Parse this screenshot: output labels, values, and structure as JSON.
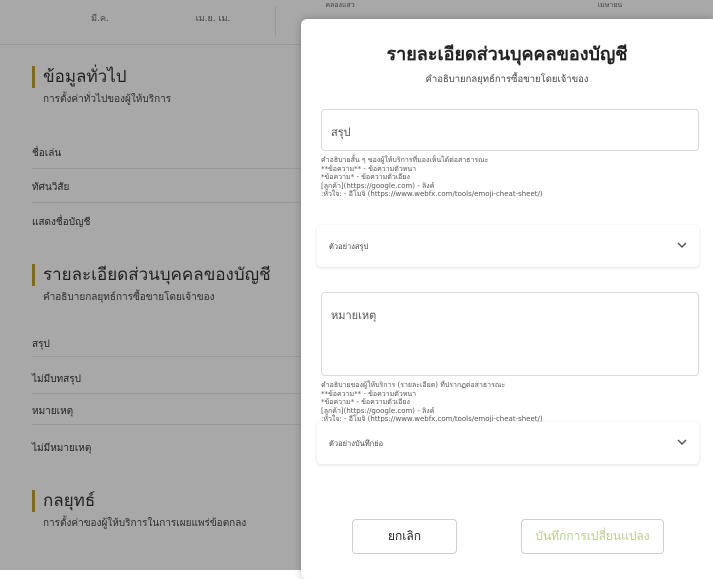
{
  "background": {
    "header": {
      "col1": "มี.ค.",
      "col2": "เม.ย. เม.",
      "col3_top": "คลองแสว",
      "col4_top": "เมษายน"
    },
    "general": {
      "title": "ข้อมูลทั่วไป",
      "desc": "การตั้งค่าทั่วไปของผู้ให้บริการ",
      "rows": [
        "ชื่อเล่น",
        "ทัศนวิสัย",
        "แสดงชื่อบัญชี"
      ]
    },
    "account": {
      "title": "รายละเอียดส่วนบุคคลของบัญชี",
      "desc": "คำอธิบายกลยุทธ์การซื้อขายโดยเจ้าของ",
      "rows": [
        "สรุป",
        "ไม่มีบทสรุป",
        "หมายเหตุ",
        "ไม่มีหมายเหตุ"
      ]
    },
    "strategy": {
      "title": "กลยุทธ์",
      "desc": "การตั้งค่าของผู้ให้บริการในการเผยแพร่ข้อตกลง"
    }
  },
  "modal": {
    "title": "รายละเอียดส่วนบุคคลของบัญชี",
    "subtitle": "คำอธิบายกลยุทธ์การซื้อขายโดยเจ้าของ",
    "summary": {
      "placeholder": "สรุป",
      "help": [
        "คำอธิบายสั้น ๆ ของผู้ให้บริการที่มองเห็นได้ต่อสาธารณะ",
        "**ข้อความ** - ข้อความตัวหนา",
        "*ข้อความ* - ข้อความตัวเอียง",
        "[ลูกค้า](https://google.com) - ลิงค์",
        ":หัวใจ: - อีโมจิ (https://www.webfx.com/tools/emoji-cheat-sheet/)"
      ],
      "example_label": "ตัวอย่างสรุป"
    },
    "note": {
      "placeholder": "หมายเหตุ",
      "help": [
        "คำอธิบายของผู้ให้บริการ (รายละเอียด) ที่ปรากฏต่อสาธารณะ",
        "**ข้อความ** - ข้อความตัวหนา",
        "*ข้อความ* - ข้อความตัวเอียง",
        "[ลูกค้า](https://google.com) - ลิงค์",
        ":หัวใจ: - อีโมจิ (https://www.webfx.com/tools/emoji-cheat-sheet/)"
      ],
      "example_label": "ตัวอย่างบันทึกย่อ"
    },
    "cancel_label": "ยกเลิก",
    "save_label": "บันทึกการเปลี่ยนแปลง"
  },
  "colors": {
    "accent": "#c9a400",
    "save_text": "#b9cf8a"
  },
  "icons": {
    "dropdown": "chevron-down-icon"
  }
}
